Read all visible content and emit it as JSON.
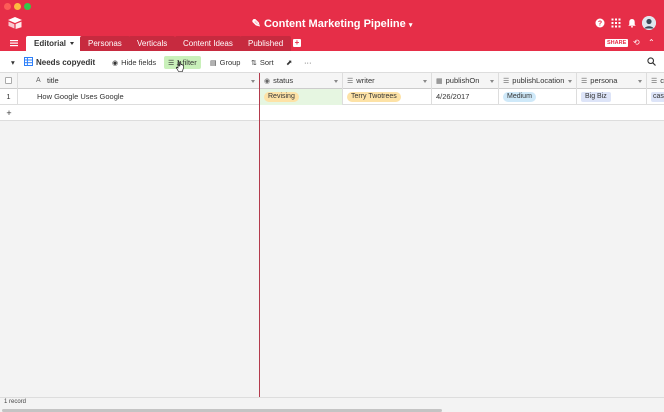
{
  "app": {
    "base_title": "Content Marketing Pipeline",
    "accent": "#e62e48"
  },
  "tabs": [
    {
      "label": "Editorial",
      "active": true
    },
    {
      "label": "Personas",
      "active": false
    },
    {
      "label": "Verticals",
      "active": false
    },
    {
      "label": "Content Ideas",
      "active": false
    },
    {
      "label": "Published",
      "active": false
    }
  ],
  "header_right": {
    "share_label": "SHARE"
  },
  "viewbar": {
    "view_name": "Needs copyedit",
    "hide_fields": "Hide fields",
    "filter": "1 filter",
    "group": "Group",
    "sort": "Sort",
    "more": "···"
  },
  "grid": {
    "columns": [
      {
        "label": "title",
        "icon": "text-icon"
      },
      {
        "label": "status",
        "icon": "single-select-icon"
      },
      {
        "label": "writer",
        "icon": "link-icon"
      },
      {
        "label": "publishOn",
        "icon": "calendar-icon"
      },
      {
        "label": "publishLocation",
        "icon": "link-icon"
      },
      {
        "label": "persona",
        "icon": "link-icon"
      },
      {
        "label": "c",
        "icon": "link-icon"
      }
    ],
    "rows": [
      {
        "num": "1",
        "title": "How Google Uses Google",
        "status": "Revising",
        "writer": "Terry Twotrees",
        "publishOn": "4/26/2017",
        "publishLocation": "Medium",
        "persona": "Big Biz",
        "extra": "cas"
      }
    ],
    "add_row_label": "+"
  },
  "footer": {
    "record_count": "1 record"
  },
  "colors": {
    "status_pill": "#fde2a6",
    "writer_pill": "#fde2a6",
    "location_pill": "#cfe9f9",
    "persona_pill": "#dde4f8",
    "status_cell_bg": "#e6f6e1",
    "filter_bg": "#c9f0ba"
  }
}
